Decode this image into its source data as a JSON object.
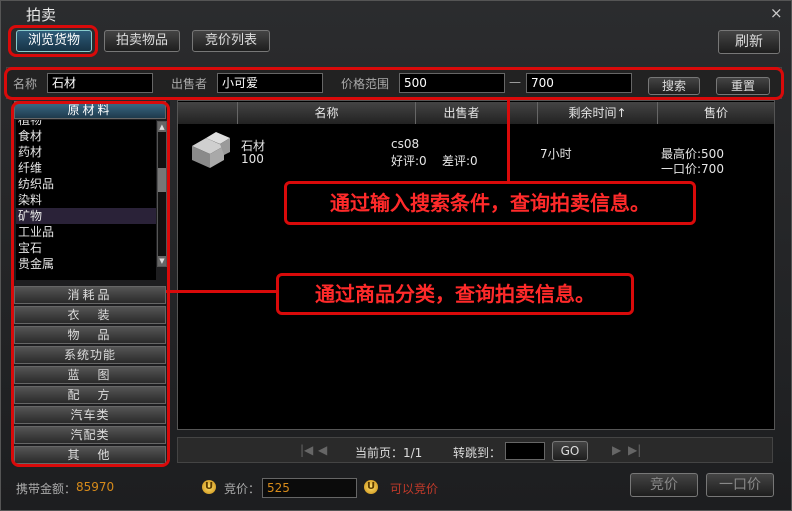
{
  "window": {
    "title": "拍卖",
    "close_glyph": "×"
  },
  "tabs": [
    {
      "label": "浏览货物",
      "active": true
    },
    {
      "label": "拍卖物品",
      "active": false
    },
    {
      "label": "竞价列表",
      "active": false
    }
  ],
  "refresh_label": "刷新",
  "search": {
    "name_label": "名称",
    "name_value": "石材",
    "seller_label": "出售者",
    "seller_value": "小可爱",
    "price_label": "价格范围",
    "price_min": "500",
    "price_sep": "—",
    "price_max": "700",
    "search_button": "搜索",
    "reset_button": "重置"
  },
  "categories": {
    "open_header": "原材料",
    "items": [
      "植物",
      "食材",
      "药材",
      "纤维",
      "纺织品",
      "染料",
      "矿物",
      "工业品",
      "宝石",
      "贵金属"
    ],
    "selected_index": 6,
    "collapsed": [
      "消耗品",
      "衣　装",
      "物　品",
      "系统功能",
      "蓝　图",
      "配　方",
      "汽车类",
      "汽配类",
      "其　他"
    ]
  },
  "table": {
    "headers": {
      "name": "名称",
      "seller": "出售者",
      "time": "剩余时间↑",
      "price": "售价"
    },
    "rows": [
      {
        "name": "石材",
        "qty": "100",
        "seller": "cs08",
        "good": "好评:0",
        "bad": "差评:0",
        "time": "7小时",
        "max_price": "最高价:500",
        "buyout": "一口价:700"
      }
    ]
  },
  "annotations": {
    "search_callout": "通过输入搜索条件，查询拍卖信息。",
    "category_callout": "通过商品分类，查询拍卖信息。"
  },
  "pager": {
    "first": "|◀",
    "prev": "◀",
    "label": "当前页：1/1",
    "jump_label": "转跳到：",
    "go": "GO",
    "next": "▶",
    "last": "▶|"
  },
  "footer": {
    "money_label": "携带金额：",
    "money_value": "85970",
    "coin_glyph": "U",
    "bid_label": "竞价：",
    "bid_value": "525",
    "bid_status": "可以竞价",
    "bid_button": "竞价",
    "buyout_button": "一口价"
  },
  "colors": {
    "accent_red": "#d90a0a",
    "money": "#d68a1a",
    "status": "#c23a2a"
  }
}
